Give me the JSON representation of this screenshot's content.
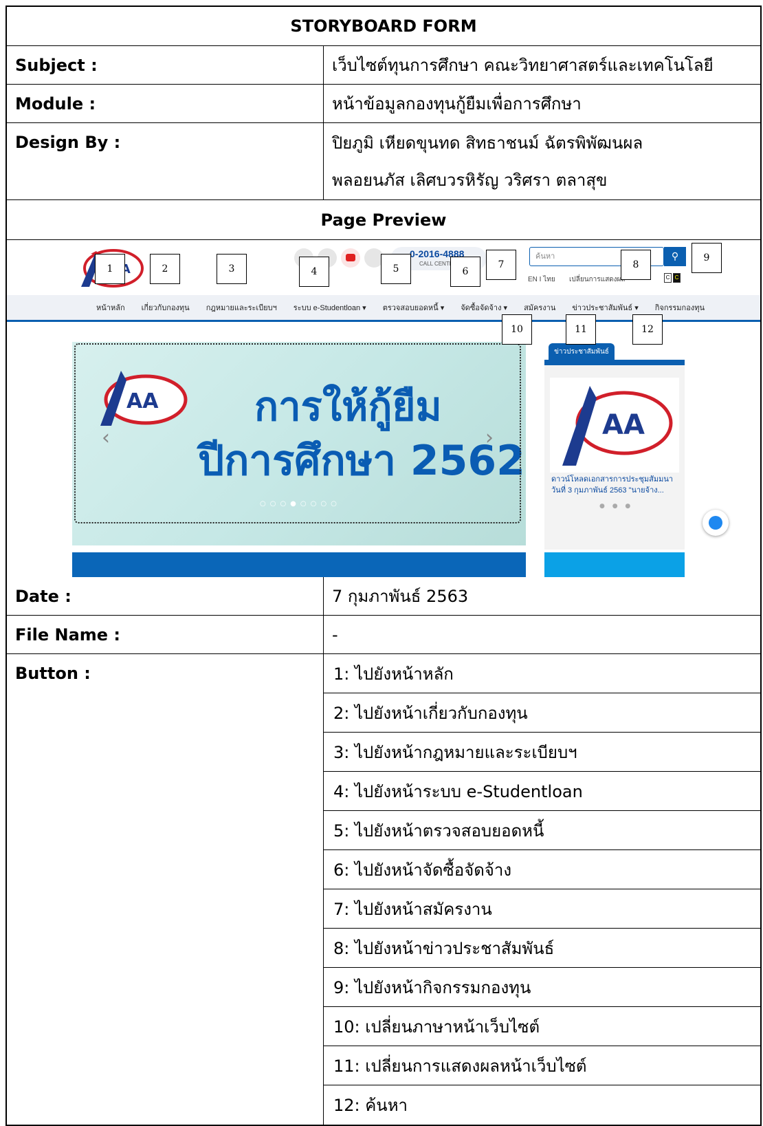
{
  "form_title": "STORYBOARD FORM",
  "subject": {
    "label": "Subject  :",
    "value": "เว็บไซต์ทุนการศึกษา คณะวิทยาศาสตร์และเทคโนโลยี"
  },
  "module": {
    "label": "Module :",
    "value": "หน้าข้อมูลกองทุนกู้ยืมเพื่อการศึกษา"
  },
  "design_by": {
    "label": "Design By  :",
    "line1": "ปิยภูมิ เหียดขุนทด  สิทธาชนม์ ฉัตรพิพัฒนผล",
    "line2": "พลอยนภัส เลิศบวรหิรัญ  วริศรา ตลาสุข"
  },
  "page_preview_title": "Page Preview",
  "preview": {
    "nav_items": [
      "หน้าหลัก",
      "เกี่ยวกับกองทุน",
      "กฎหมายและระเบียบฯ",
      "ระบบ e-Studentloan ▾",
      "ตรวจสอบยอดหนี้ ▾",
      "จัดซื้อจัดจ้าง ▾",
      "สมัครงาน",
      "ข่าวประชาสัมพันธ์ ▾",
      "กิจกรรมกองทุน"
    ],
    "phone": "0-2016-4888",
    "call_center": "CALL CENTER",
    "search_placeholder": "ค้นหา",
    "lang": "EN  I ไทย",
    "display_toggle": "เปลี่ยนการแสดงผล",
    "contrast": [
      "C",
      "C"
    ],
    "banner_line1": "การให้กู้ยืม",
    "banner_line2": "ปีการศึกษา 2562",
    "side_tab": "ข่าวประชาสัมพันธ์",
    "side_caption_line1": "ดาวน์โหลดเอกสารการประชุมสัมมนา",
    "side_caption_line2": "วันที่ 3 กุมภาพันธ์ 2563 \"นายจ้าง...",
    "markers": [
      "1",
      "2",
      "3",
      "4",
      "5",
      "6",
      "7",
      "8",
      "9",
      "10",
      "11",
      "12"
    ],
    "colors": {
      "brand_blue": "#0b5fb0",
      "banner_bg": "#c6e8e6"
    }
  },
  "date": {
    "label": "Date  :",
    "value": "7 กุมภาพันธ์ 2563"
  },
  "file_name": {
    "label": "File Name  :",
    "value": "-"
  },
  "button": {
    "label": "Button  :",
    "items": [
      "1: ไปยังหน้าหลัก",
      "2: ไปยังหน้าเกี่ยวกับกองทุน",
      "3: ไปยังหน้ากฎหมายและระเบียบฯ",
      "4: ไปยังหน้าระบบ e-Studentloan",
      "5: ไปยังหน้าตรวจสอบยอดหนี้",
      "6: ไปยังหน้าจัดซื้อจัดจ้าง",
      "7: ไปยังหน้าสมัครงาน",
      "8: ไปยังหน้าข่าวประชาสัมพันธ์",
      "9: ไปยังหน้ากิจกรรมกองทุน",
      "10: เปลี่ยนภาษาหน้าเว็บไซต์",
      "11: เปลี่ยนการแสดงผลหน้าเว็บไซต์",
      "12: ค้นหา"
    ]
  }
}
